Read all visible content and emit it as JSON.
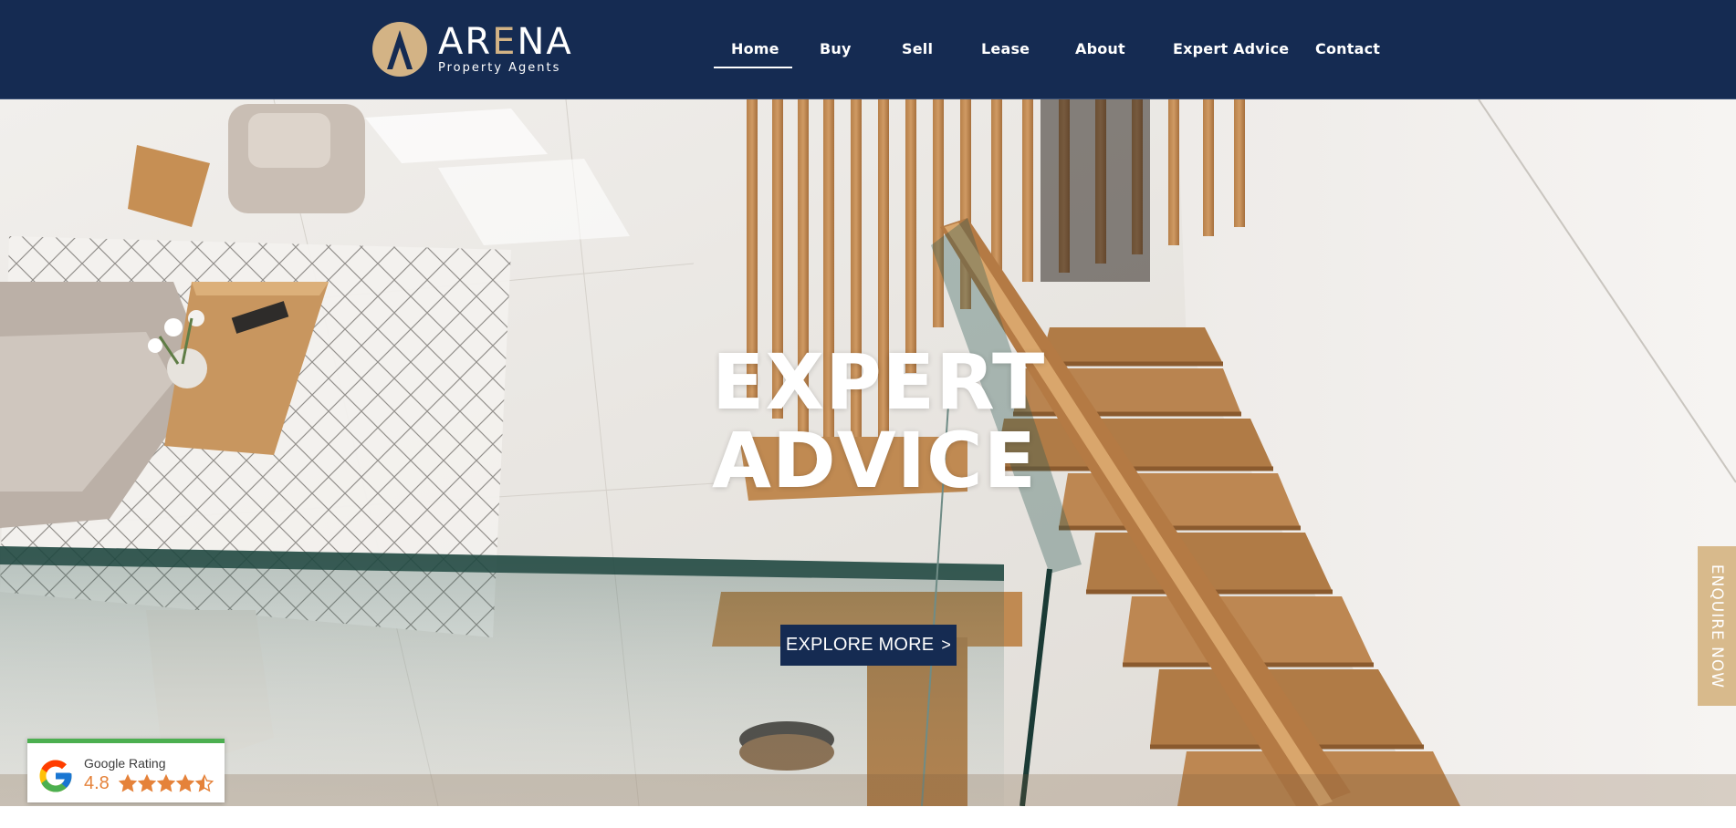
{
  "brand": {
    "name_prefix": "AR",
    "name_accent": "E",
    "name_suffix": "NA",
    "tagline": "Property Agents",
    "colors": {
      "navy": "#152b52",
      "gold": "#d3b385"
    }
  },
  "nav": {
    "items": [
      {
        "label": "Home",
        "active": true
      },
      {
        "label": "Buy"
      },
      {
        "label": "Sell"
      },
      {
        "label": "Lease"
      },
      {
        "label": "About"
      },
      {
        "label": "Expert Advice"
      },
      {
        "label": "Contact"
      }
    ]
  },
  "hero": {
    "title_line1": "EXPERT",
    "title_line2": "ADVICE",
    "cta_label": "EXPLORE MORE",
    "cta_icon": "chevron-right-icon",
    "image_subject": "staircase-interior-photo"
  },
  "enquire": {
    "label": "ENQUIRE NOW"
  },
  "google_rating": {
    "label": "Google Rating",
    "score": "4.8",
    "stars_value": 4.8,
    "stars_max": 5,
    "star_color": "#e5823a",
    "accent_color": "#4caf50"
  }
}
